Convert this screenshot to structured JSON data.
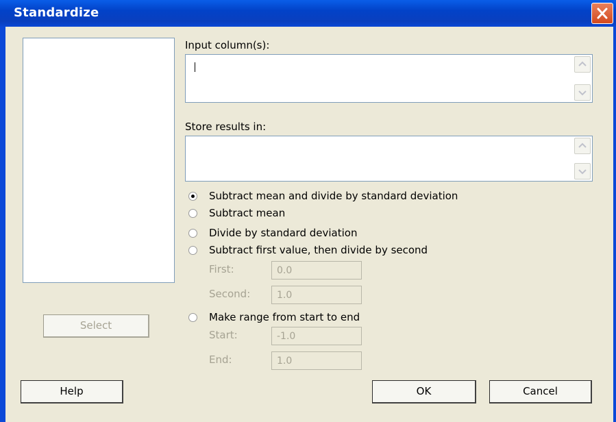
{
  "window": {
    "title": "Standardize",
    "close_icon": "close-icon"
  },
  "variables_list": {
    "items": []
  },
  "input_columns": {
    "label": "Input column(s):",
    "value": ""
  },
  "store_results": {
    "label": "Store results in:",
    "value": ""
  },
  "method": {
    "selected": "subtract_mean_divide_sd",
    "options": [
      {
        "id": "subtract_mean_divide_sd",
        "label": "Subtract mean and divide by standard deviation"
      },
      {
        "id": "subtract_mean",
        "label": "Subtract mean"
      },
      {
        "id": "divide_sd",
        "label": "Divide by standard deviation"
      },
      {
        "id": "subtract_first_divide_second",
        "label": "Subtract first value, then divide by second"
      },
      {
        "id": "make_range",
        "label": "Make range from start to end"
      }
    ],
    "first": {
      "label": "First:",
      "value": "0.0"
    },
    "second": {
      "label": "Second:",
      "value": "1.0"
    },
    "start": {
      "label": "Start:",
      "value": "-1.0"
    },
    "end": {
      "label": "End:",
      "value": "1.0"
    }
  },
  "buttons": {
    "select": "Select",
    "help": "Help",
    "ok": "OK",
    "cancel": "Cancel"
  },
  "colors": {
    "titlebar": "#0a3fbe",
    "dialog_bg": "#ece9d8",
    "close": "#d44a1e",
    "disabled_text": "#a6a393"
  }
}
